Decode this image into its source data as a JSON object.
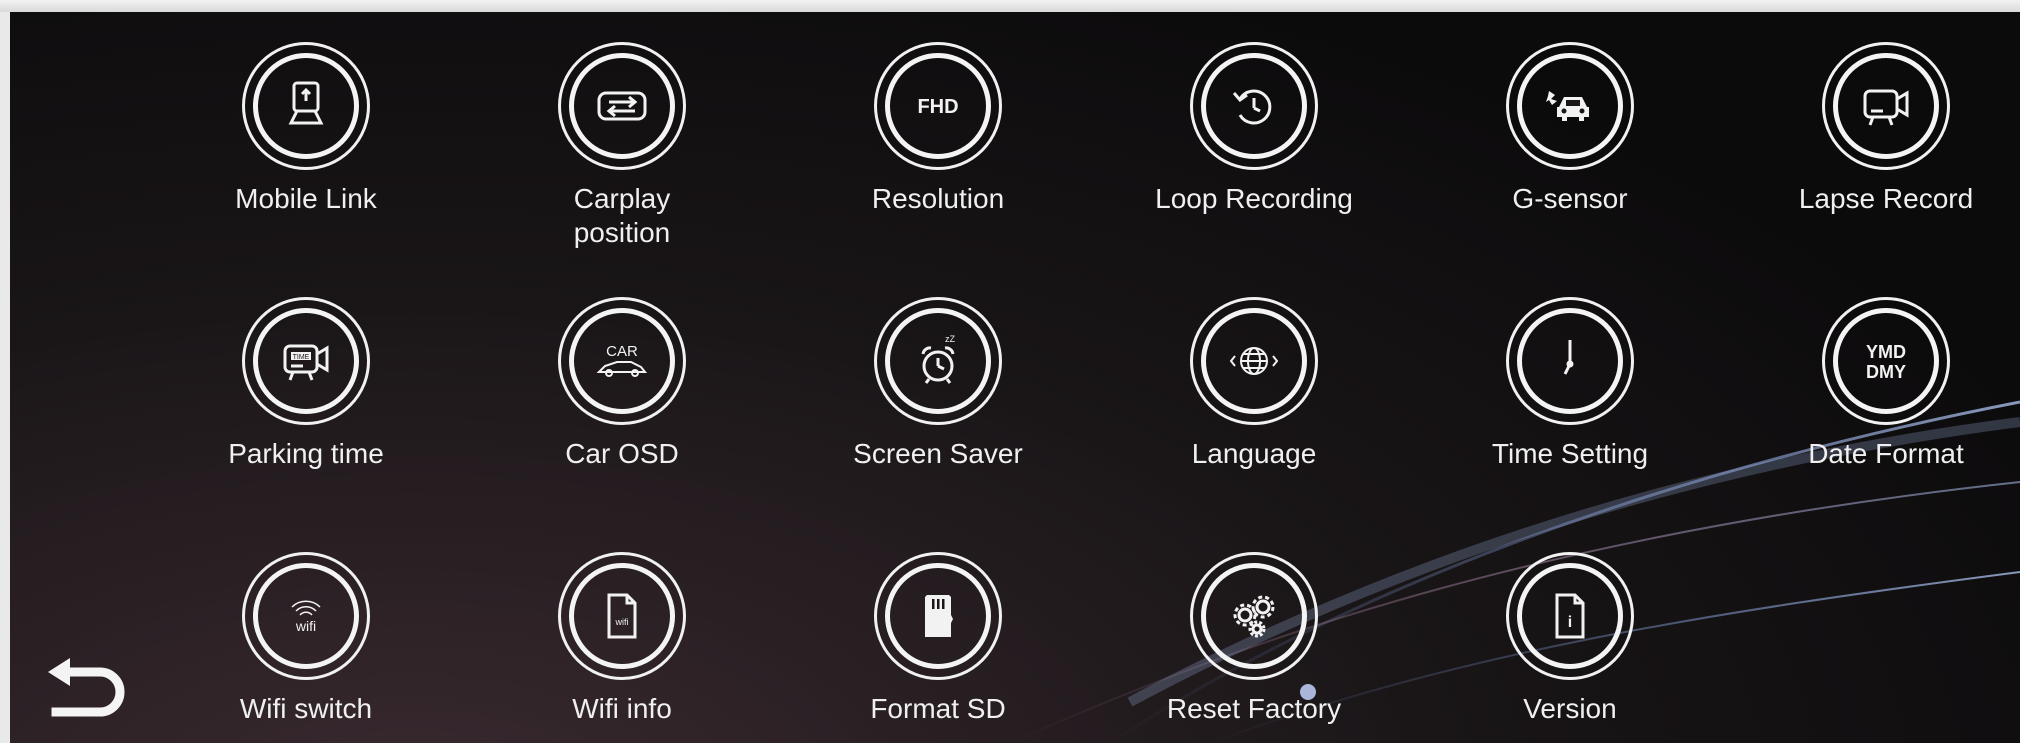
{
  "menu": {
    "items": [
      {
        "label": "Mobile Link",
        "icon": "mobile-link-icon"
      },
      {
        "label": "Carplay\nposition",
        "icon": "carplay-position-icon"
      },
      {
        "label": "Resolution",
        "icon": "fhd-icon",
        "icon_text": "FHD"
      },
      {
        "label": "Loop Recording",
        "icon": "loop-recording-icon"
      },
      {
        "label": "G-sensor",
        "icon": "g-sensor-icon"
      },
      {
        "label": "Lapse Record",
        "icon": "lapse-record-icon"
      },
      {
        "label": "Parking time",
        "icon": "parking-time-icon",
        "icon_text": "TIME"
      },
      {
        "label": "Car OSD",
        "icon": "car-osd-icon",
        "icon_text": "CAR"
      },
      {
        "label": "Screen Saver",
        "icon": "alarm-clock-icon",
        "icon_text": "zZ"
      },
      {
        "label": "Language",
        "icon": "globe-icon"
      },
      {
        "label": "Time Setting",
        "icon": "clock-icon"
      },
      {
        "label": "Date Format",
        "icon": "date-format-icon",
        "icon_text": "YMD",
        "icon_text2": "DMY"
      },
      {
        "label": "Wifi switch",
        "icon": "wifi-switch-icon",
        "icon_text": "wifi"
      },
      {
        "label": "Wifi info",
        "icon": "wifi-info-icon",
        "icon_text": "wifi"
      },
      {
        "label": "Format SD",
        "icon": "sd-card-icon"
      },
      {
        "label": "Reset Factory",
        "icon": "gears-icon"
      },
      {
        "label": "Version",
        "icon": "version-icon",
        "icon_text": "i"
      }
    ]
  },
  "back": {
    "icon": "back-arrow-icon"
  },
  "colors": {
    "background": "#121012",
    "foreground": "#f2f2f2",
    "accent_swoosh": "#8fa8d8"
  }
}
